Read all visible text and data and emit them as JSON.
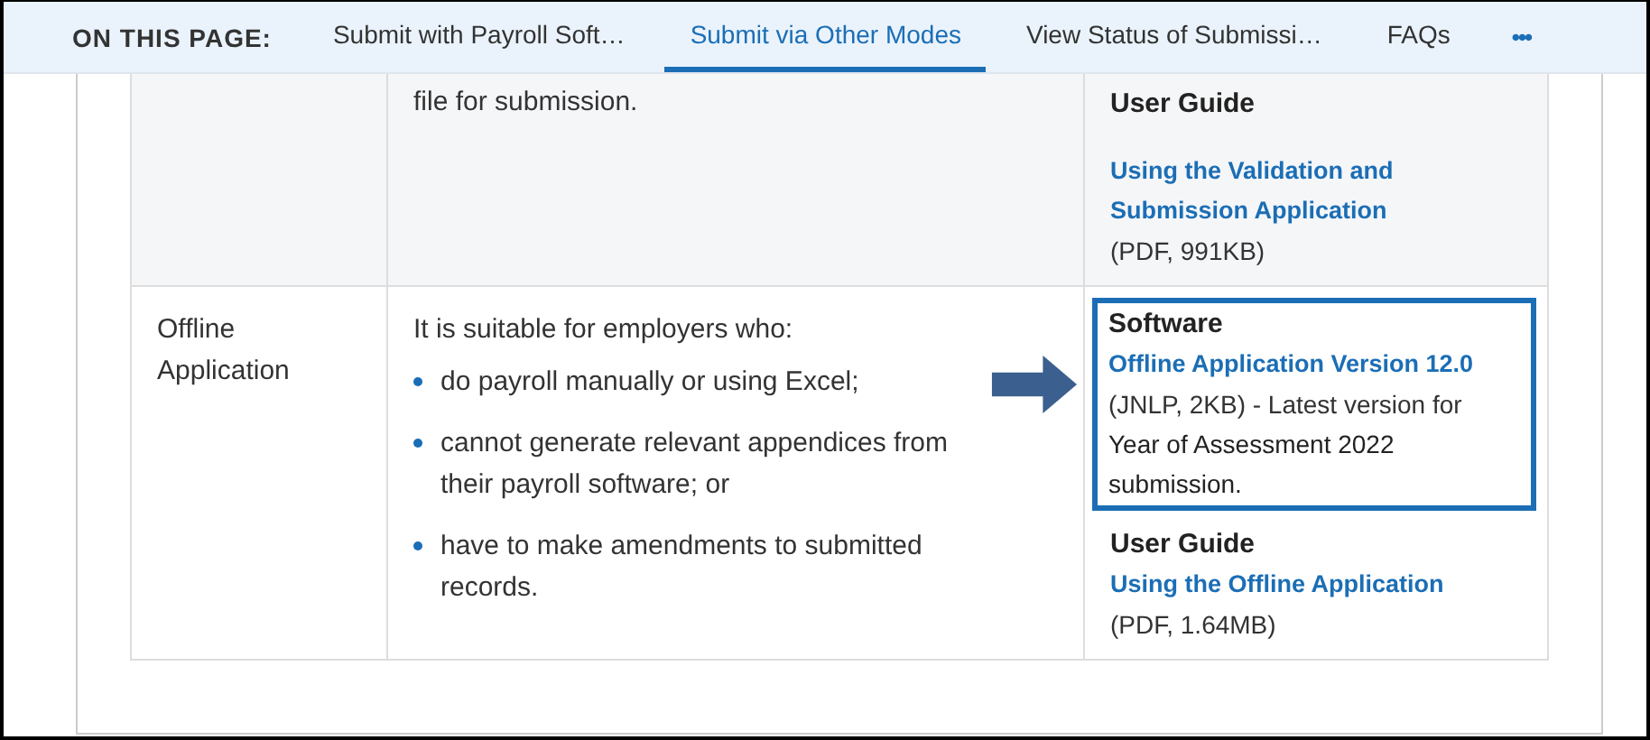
{
  "nav": {
    "label": "ON THIS PAGE:",
    "tabs": [
      {
        "label": "Submit with Payroll Soft…",
        "selected": false
      },
      {
        "label": "Submit via Other Modes",
        "selected": true
      },
      {
        "label": "View Status of Submissi…",
        "selected": false
      },
      {
        "label": "FAQs",
        "selected": false
      }
    ],
    "more": "•••"
  },
  "table": {
    "rows": [
      {
        "column_1": "",
        "column_2": {
          "lines": [
            "file for submission."
          ]
        },
        "column_3": {
          "sections": [
            {
              "heading": "User Guide",
              "link": "Using the Validation and Submission Application",
              "note": "(PDF, 991KB)"
            }
          ]
        }
      },
      {
        "column_1": "Offline Application",
        "column_2": {
          "lines": [
            "It is suitable for employers who:"
          ],
          "bullets": [
            "do payroll manually or using Excel;",
            "cannot generate relevant appendices from their payroll software; or",
            "have to make amendments to submitted records."
          ]
        },
        "column_3": {
          "highlighted": true,
          "sections": [
            {
              "heading": "Software",
              "link": "Offline Application Version 12.0",
              "note": "(JNLP, 2KB) - Latest version for",
              "extra": "Year of Assessment 2022 submission."
            },
            {
              "heading": "User Guide",
              "link": "Using the Offline Application",
              "note": "(PDF, 1.64MB)"
            }
          ]
        }
      }
    ]
  }
}
